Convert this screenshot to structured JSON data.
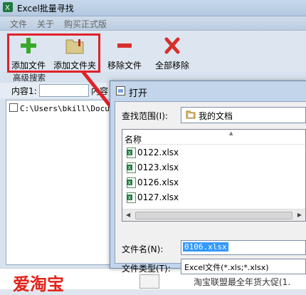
{
  "app": {
    "title": "Excel批量寻找",
    "menu": [
      "文件",
      "关于",
      "购买正式版"
    ],
    "toolbar": {
      "add_file": "添加文件",
      "add_folder": "添加文件夹",
      "remove_file": "移除文件",
      "remove_all": "全部移除"
    },
    "advanced_search": "高级搜索",
    "content1_label": "内容1:",
    "content2_label": "内容",
    "list_item": "C:\\Users\\bkill\\Docume",
    "ad_big": "爱淘宝",
    "ad_small": "淘宝联盟最全年货大促(1.",
    "accent_color": "#e0212a"
  },
  "dialog": {
    "title": "打开",
    "look_in_label": "查找范围(I):",
    "look_in_value": "我的文档",
    "column_name": "名称",
    "files": [
      "0122.xlsx",
      "0123.xlsx",
      "0126.xlsx",
      "0127.xlsx"
    ],
    "filename_label": "文件名(N):",
    "filename_value": "0106.xlsx",
    "filetype_label": "文件类型(T):",
    "filetype_value": "Excel文件(*.xls;*.xlsx)"
  }
}
